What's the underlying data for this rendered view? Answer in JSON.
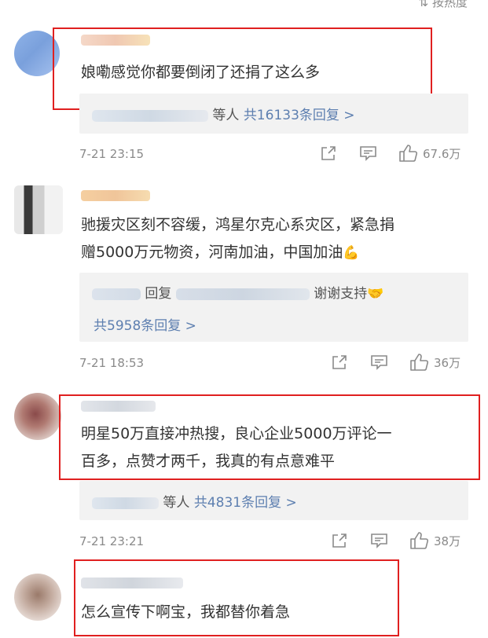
{
  "sort_label": "按热度",
  "comments": [
    {
      "text": "娘嘞感觉你都要倒闭了还捐了这么多",
      "reply_suffix": "等人",
      "reply_count": "共16133条回复 >",
      "time": "7-21 23:15",
      "likes": "67.6万"
    },
    {
      "text_line1": "驰援灾区刻不容缓，鸿星尔克心系灾区，紧急捐",
      "text_line2": "赠5000万元物资，河南加油，中国加油",
      "text_emoji": "💪",
      "reply_text_a": "回复",
      "reply_text_b": "谢谢支持",
      "reply_emoji": "🤝",
      "reply_count": "共5958条回复 >",
      "time": "7-21 18:53",
      "likes": "36万"
    },
    {
      "text_line1": "明星50万直接冲热搜，良心企业5000万评论一",
      "text_line2": "百多，点赞才两千，我真的有点意难平",
      "reply_suffix": "等人",
      "reply_count": "共4831条回复 >",
      "time": "7-21 23:21",
      "likes": "38万"
    },
    {
      "text": "怎么宣传下啊宝，我都替你着急"
    }
  ]
}
